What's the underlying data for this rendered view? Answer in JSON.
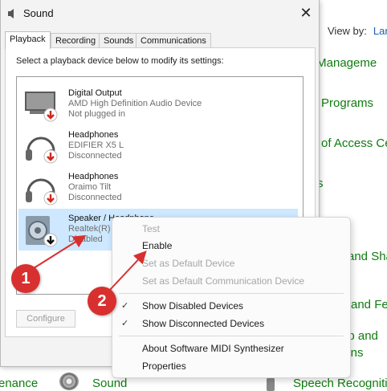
{
  "background": {
    "view_by_label": "View by:",
    "view_by_value": "Lar",
    "links": [
      "r Manageme",
      "ult Programs",
      "of Access Ce",
      "s",
      "and Sha",
      "and Fe",
      "op and",
      "ions"
    ],
    "bottom_items": [
      "enance",
      "Sound",
      "Speech Recogniti"
    ]
  },
  "dialog": {
    "title": "Sound",
    "close": "✕",
    "tabs": [
      "Playback",
      "Recording",
      "Sounds",
      "Communications"
    ],
    "instruction": "Select a playback device below to modify its settings:",
    "devices": [
      {
        "name": "Digital Output",
        "line1": "AMD High Definition Audio Device",
        "line2": "Not plugged in"
      },
      {
        "name": "Headphones",
        "line1": "EDIFIER X5 L",
        "line2": "Disconnected"
      },
      {
        "name": "Headphones",
        "line1": "Oraimo Tilt",
        "line2": "Disconnected"
      },
      {
        "name": "Speaker / Headphone",
        "line1": "Realtek(R) ",
        "line2": "Disabled"
      }
    ],
    "configure": "Configure"
  },
  "context_menu": {
    "test": "Test",
    "enable": "Enable",
    "set_default": "Set as Default Device",
    "set_default_comm": "Set as Default Communication Device",
    "show_disabled": "Show Disabled Devices",
    "show_disconnected": "Show Disconnected Devices",
    "about_midi": "About Software MIDI Synthesizer",
    "properties": "Properties",
    "check": "✓"
  },
  "annotations": {
    "one": "1",
    "two": "2"
  },
  "colors": {
    "link_green": "#107c10",
    "selected": "#cde8ff",
    "callout_red": "#d8302e"
  }
}
